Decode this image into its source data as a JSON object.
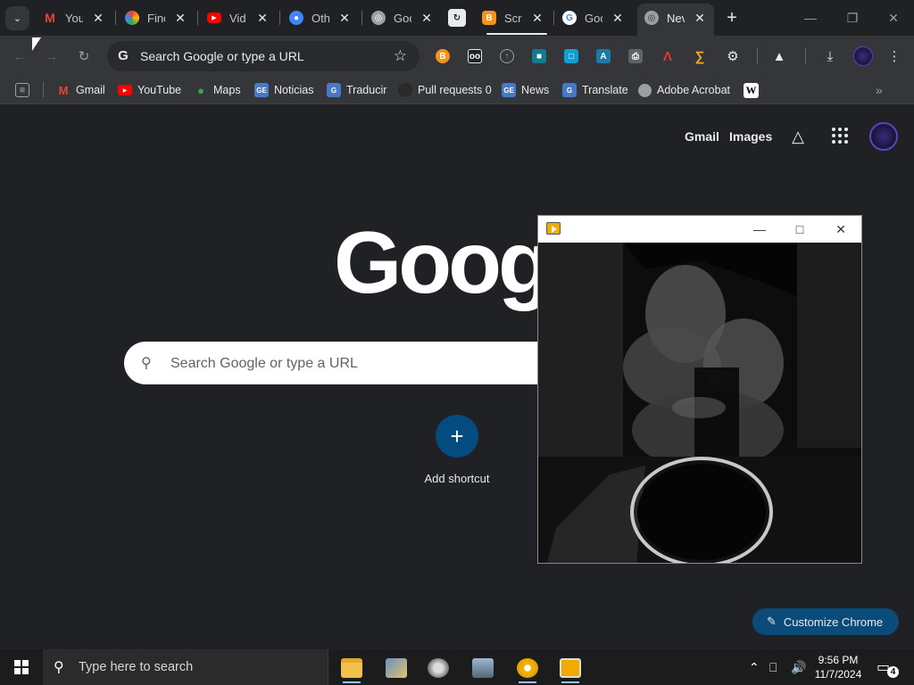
{
  "tabs": [
    {
      "title": "You",
      "icon": "gmail-icon",
      "color": "#ea4335"
    },
    {
      "title": "Finc",
      "icon": "gemini-icon",
      "color": "#8ab4f8"
    },
    {
      "title": "Vid",
      "icon": "youtube-icon",
      "color": "#ff0000"
    },
    {
      "title": "Oth",
      "icon": "user-icon",
      "color": "#4285f4"
    },
    {
      "title": "Goo",
      "icon": "globe-icon",
      "color": "#9aa0a6"
    },
    {
      "title": "",
      "icon": "sync-icon",
      "color": "#e8eaed"
    },
    {
      "title": "Scr",
      "icon": "b-icon",
      "color": "#f7931a"
    },
    {
      "title": "Goo",
      "icon": "google-icon",
      "color": "#4285f4"
    },
    {
      "title": "Nev",
      "icon": "chrome-icon",
      "color": "#9aa0a6",
      "active": true
    }
  ],
  "omnibox": {
    "placeholder": "Search Google or type a URL"
  },
  "bookmarks": [
    {
      "label": "Gmail",
      "icon": "gmail-icon"
    },
    {
      "label": "YouTube",
      "icon": "youtube-icon"
    },
    {
      "label": "Maps",
      "icon": "maps-icon"
    },
    {
      "label": "Noticias",
      "icon": "news-icon"
    },
    {
      "label": "Traducir",
      "icon": "translate-icon"
    },
    {
      "label": "Pull requests 0",
      "icon": "github-icon"
    },
    {
      "label": "News",
      "icon": "news-icon"
    },
    {
      "label": "Translate",
      "icon": "translate-icon"
    },
    {
      "label": "Adobe Acrobat",
      "icon": "globe-icon"
    },
    {
      "label": "W",
      "icon": "wikipedia-icon"
    }
  ],
  "ntp": {
    "links": {
      "gmail": "Gmail",
      "images": "Images"
    },
    "logo": "Google",
    "search_placeholder": "Search Google or type a URL",
    "add_shortcut": "Add shortcut",
    "customize": "Customize Chrome"
  },
  "taskbar": {
    "search_placeholder": "Type here to search",
    "time": "9:56 PM",
    "date": "11/7/2024",
    "notifications": "4"
  },
  "colors": {
    "bg": "#202124",
    "toolbar": "#35363a",
    "accent": "#0b4b7a",
    "shortcut": "#044b7f"
  }
}
